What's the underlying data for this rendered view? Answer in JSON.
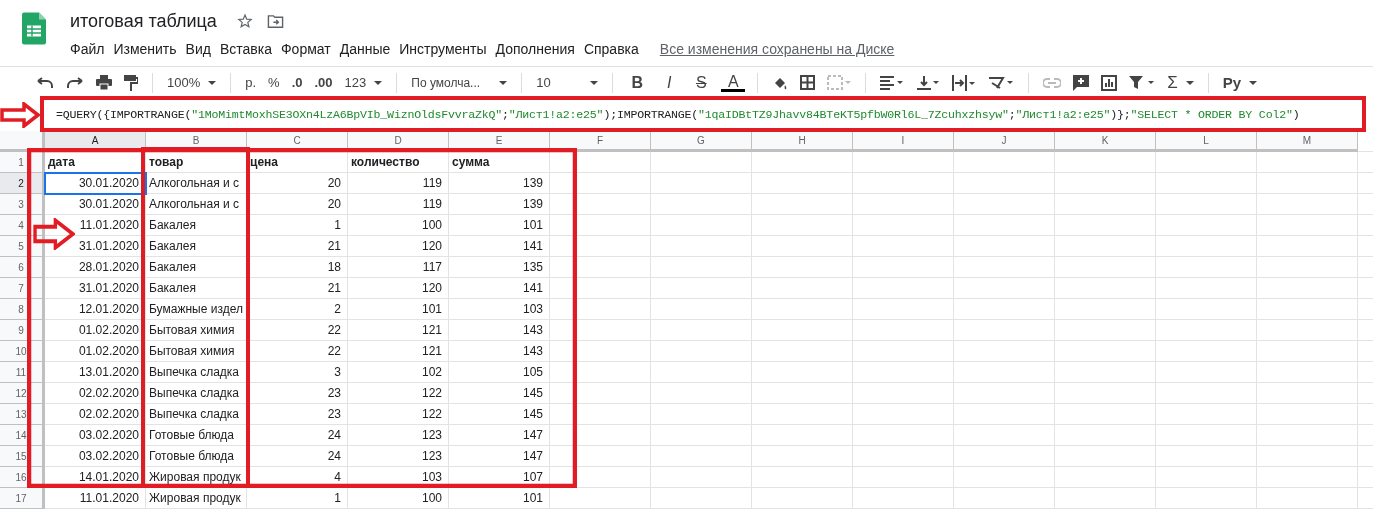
{
  "document": {
    "title": "итоговая таблица"
  },
  "menu": [
    "Файл",
    "Изменить",
    "Вид",
    "Вставка",
    "Формат",
    "Данные",
    "Инструменты",
    "Дополнения",
    "Справка"
  ],
  "save_status": "Все изменения сохранены на Диске",
  "toolbar": {
    "zoom": "100%",
    "currency": "р.",
    "percent": "%",
    "decimal_less": ".0",
    "decimal_more": ".00",
    "number_format": "123",
    "font": "По умолча...",
    "font_size": "10",
    "bold": "B",
    "italic": "I",
    "strike": "S",
    "text_color": "A",
    "functions": "Σ",
    "input_tools": "Pу"
  },
  "formula": [
    {
      "kind": "plain",
      "text": "=QUERY({IMPORTRANGE("
    },
    {
      "kind": "string",
      "text": "\"1MoMimtMoxhSE3OXn4LzA6BpVIb_WiznOldsFvvraZkQ\""
    },
    {
      "kind": "plain",
      "text": ";"
    },
    {
      "kind": "string",
      "text": "\"Лист1!a2:e25\""
    },
    {
      "kind": "plain",
      "text": ");IMPORTRANGE("
    },
    {
      "kind": "string",
      "text": "\"1qaIDBtTZ9Jhavv84BTeKT5pfbW0Rl6L_7Zcuhxzhsyw\""
    },
    {
      "kind": "plain",
      "text": ";"
    },
    {
      "kind": "string",
      "text": "\"Лист1!a2:e25\""
    },
    {
      "kind": "plain",
      "text": ")};"
    },
    {
      "kind": "string",
      "text": "\"SELECT * ORDER BY Col2\""
    },
    {
      "kind": "plain",
      "text": ")"
    }
  ],
  "columns": [
    {
      "letter": "A",
      "selected": true,
      "numeric": true
    },
    {
      "letter": "B",
      "selected": false,
      "numeric": false
    },
    {
      "letter": "C",
      "selected": false,
      "numeric": true
    },
    {
      "letter": "D",
      "selected": false,
      "numeric": true
    },
    {
      "letter": "E",
      "selected": false,
      "numeric": true
    },
    {
      "letter": "F",
      "selected": false
    },
    {
      "letter": "G",
      "selected": false
    },
    {
      "letter": "H",
      "selected": false
    },
    {
      "letter": "I",
      "selected": false
    },
    {
      "letter": "J",
      "selected": false
    },
    {
      "letter": "K",
      "selected": false
    },
    {
      "letter": "L",
      "selected": false
    },
    {
      "letter": "M",
      "selected": false
    }
  ],
  "rows": [
    {
      "number": "1",
      "selected": false,
      "bold": true,
      "cells": [
        "дата",
        "товар",
        "цена",
        "количество",
        "сумма"
      ]
    },
    {
      "number": "2",
      "selected": true,
      "bold": false,
      "cells": [
        "30.01.2020",
        "Алкогольная и с",
        "20",
        "119",
        "139"
      ]
    },
    {
      "number": "3",
      "selected": false,
      "bold": false,
      "cells": [
        "30.01.2020",
        "Алкогольная и с",
        "20",
        "119",
        "139"
      ]
    },
    {
      "number": "4",
      "selected": false,
      "bold": false,
      "cells": [
        "11.01.2020",
        "Бакалея",
        "1",
        "100",
        "101"
      ]
    },
    {
      "number": "5",
      "selected": false,
      "bold": false,
      "cells": [
        "31.01.2020",
        "Бакалея",
        "21",
        "120",
        "141"
      ]
    },
    {
      "number": "6",
      "selected": false,
      "bold": false,
      "cells": [
        "28.01.2020",
        "Бакалея",
        "18",
        "117",
        "135"
      ]
    },
    {
      "number": "7",
      "selected": false,
      "bold": false,
      "cells": [
        "31.01.2020",
        "Бакалея",
        "21",
        "120",
        "141"
      ]
    },
    {
      "number": "8",
      "selected": false,
      "bold": false,
      "cells": [
        "12.01.2020",
        "Бумажные издел",
        "2",
        "101",
        "103"
      ]
    },
    {
      "number": "9",
      "selected": false,
      "bold": false,
      "cells": [
        "01.02.2020",
        "Бытовая химия",
        "22",
        "121",
        "143"
      ]
    },
    {
      "number": "10",
      "selected": false,
      "bold": false,
      "cells": [
        "01.02.2020",
        "Бытовая химия",
        "22",
        "121",
        "143"
      ]
    },
    {
      "number": "11",
      "selected": false,
      "bold": false,
      "cells": [
        "13.01.2020",
        "Выпечка сладка",
        "3",
        "102",
        "105"
      ]
    },
    {
      "number": "12",
      "selected": false,
      "bold": false,
      "cells": [
        "02.02.2020",
        "Выпечка сладка",
        "23",
        "122",
        "145"
      ]
    },
    {
      "number": "13",
      "selected": false,
      "bold": false,
      "cells": [
        "02.02.2020",
        "Выпечка сладка",
        "23",
        "122",
        "145"
      ]
    },
    {
      "number": "14",
      "selected": false,
      "bold": false,
      "cells": [
        "03.02.2020",
        "Готовые блюда",
        "24",
        "123",
        "147"
      ]
    },
    {
      "number": "15",
      "selected": false,
      "bold": false,
      "cells": [
        "03.02.2020",
        "Готовые блюда",
        "24",
        "123",
        "147"
      ]
    },
    {
      "number": "16",
      "selected": false,
      "bold": false,
      "cells": [
        "14.01.2020",
        "Жировая продук",
        "4",
        "103",
        "107"
      ]
    },
    {
      "number": "17",
      "selected": false,
      "bold": false,
      "cells": [
        "11.01.2020",
        "Жировая продук",
        "1",
        "100",
        "101"
      ]
    }
  ]
}
